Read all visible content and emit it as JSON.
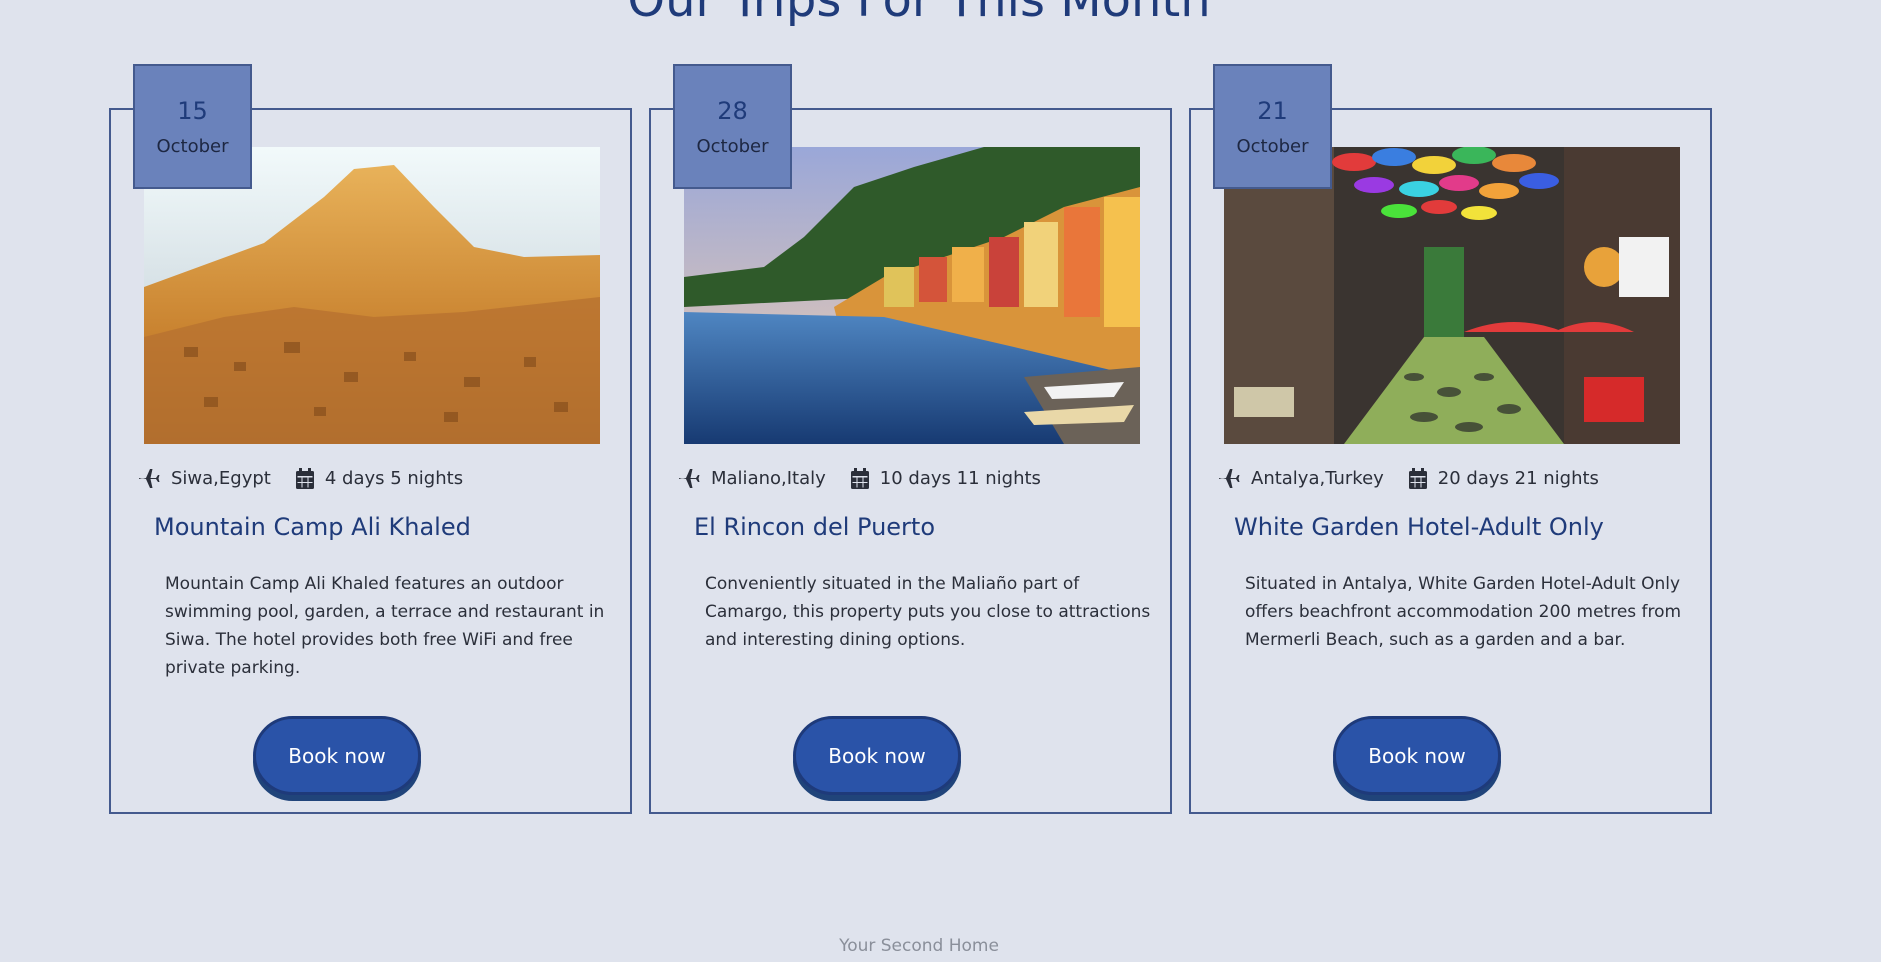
{
  "section": {
    "title": "Our Trips For This Month"
  },
  "trips": [
    {
      "day": "15",
      "month": "October",
      "location": "Siwa,Egypt",
      "duration": "4 days 5 nights",
      "title": "Mountain Camp Ali Khaled",
      "description": "Mountain Camp Ali Khaled features an outdoor swimming pool, garden, a terrace and restaurant in Siwa. The hotel provides both free WiFi and free private parking.",
      "button_label": "Book now"
    },
    {
      "day": "28",
      "month": "October",
      "location": "Maliano,Italy",
      "duration": "10 days 11 nights",
      "title": "El Rincon del Puerto",
      "description": "Conveniently situated in the Maliaño part of Camargo, this property puts you close to attractions and interesting dining options.",
      "button_label": "Book now"
    },
    {
      "day": "21",
      "month": "October",
      "location": "Antalya,Turkey",
      "duration": "20 days 21 nights",
      "title": "White Garden Hotel-Adult Only",
      "description": "Situated in Antalya, White Garden Hotel-Adult Only offers beachfront accommodation 200 metres from Mermerli Beach, such as a garden and a bar.",
      "button_label": "Book now"
    }
  ],
  "footer": {
    "text": "Your Second Home"
  },
  "icons": {
    "location": "plane-icon",
    "duration": "calendar-icon"
  },
  "colors": {
    "accent": "#2a53a8",
    "badge": "#6a82bb",
    "title": "#1f3b7a",
    "border": "#445a8e",
    "background": "#dfe3ed"
  }
}
